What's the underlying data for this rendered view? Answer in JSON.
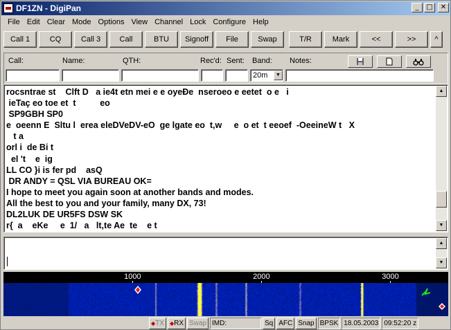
{
  "window": {
    "title": "DF1ZN - DigiPan",
    "btn_minimize": "_",
    "btn_maximize": "□",
    "btn_close": "✕"
  },
  "menu": [
    "File",
    "Edit",
    "Clear",
    "Mode",
    "Options",
    "View",
    "Channel",
    "Lock",
    "Configure",
    "Help"
  ],
  "macros": [
    "Call 1",
    "CQ",
    "Call 3",
    "Call",
    "BTU",
    "Signoff",
    "File",
    "Swap",
    "T/R",
    "Mark",
    "<<",
    ">>",
    "^"
  ],
  "log": {
    "labels": {
      "call": "Call:",
      "name": "Name:",
      "qth": "QTH:",
      "recd": "Rec'd:",
      "sent": "Sent:",
      "band": "Band:",
      "notes": "Notes:"
    },
    "values": {
      "call": "",
      "name": "",
      "qth": "",
      "recd": "",
      "sent": "",
      "band": "20m",
      "notes": ""
    },
    "icons": [
      "save-icon",
      "new-page-icon",
      "binoculars-icon"
    ]
  },
  "rx_lines": [
    "rocsntrae st    Clft D   a ie4t etn mei e e oyeĐe  nseroeo e eetet  o e   i",
    " ieTaç eo toe et  t          eo",
    " SP9GBH SP0",
    "e  oeenn E  Sltu l  erea eleDVeDV-eO  ge lgate eo  t,w     e  o et  t eeoef  -OeeineW t   X",
    "   t a",
    "orl i  de Bi t",
    "  el 't    e  ig",
    "LL CO }i is fer pd    asQ",
    " DR ANDY = QSL VIA BUREAU OK=",
    "I hope to meet you again soon at another bands and modes.",
    "All the best to you and your family, many DX, 73!",
    "DL2LUK DE UR5FS DSW SK",
    "r{  a    eKe     e  1/   a   lt,te Ae  te    e t"
  ],
  "tx_text": "",
  "waterfall": {
    "scale_labels": [
      "1000",
      "2000",
      "3000"
    ],
    "scale_freqs": [
      1000,
      2000,
      3000
    ],
    "freq_min": 0,
    "freq_max": 3450,
    "cursor_freq": 1040
  },
  "status": {
    "tx": "TX",
    "rx": "RX",
    "swap": "Swap",
    "imd": "IMD:",
    "sq": "Sq",
    "afc": "AFC",
    "snap": "Snap",
    "mode": "BPSK",
    "date": "18.05.2003",
    "time": "09:52:20 z"
  },
  "colors": {
    "titlebar_start": "#0a246a",
    "titlebar_end": "#a6caf0",
    "waterfall_bg": "#00008b",
    "signal": "#ffff40"
  }
}
